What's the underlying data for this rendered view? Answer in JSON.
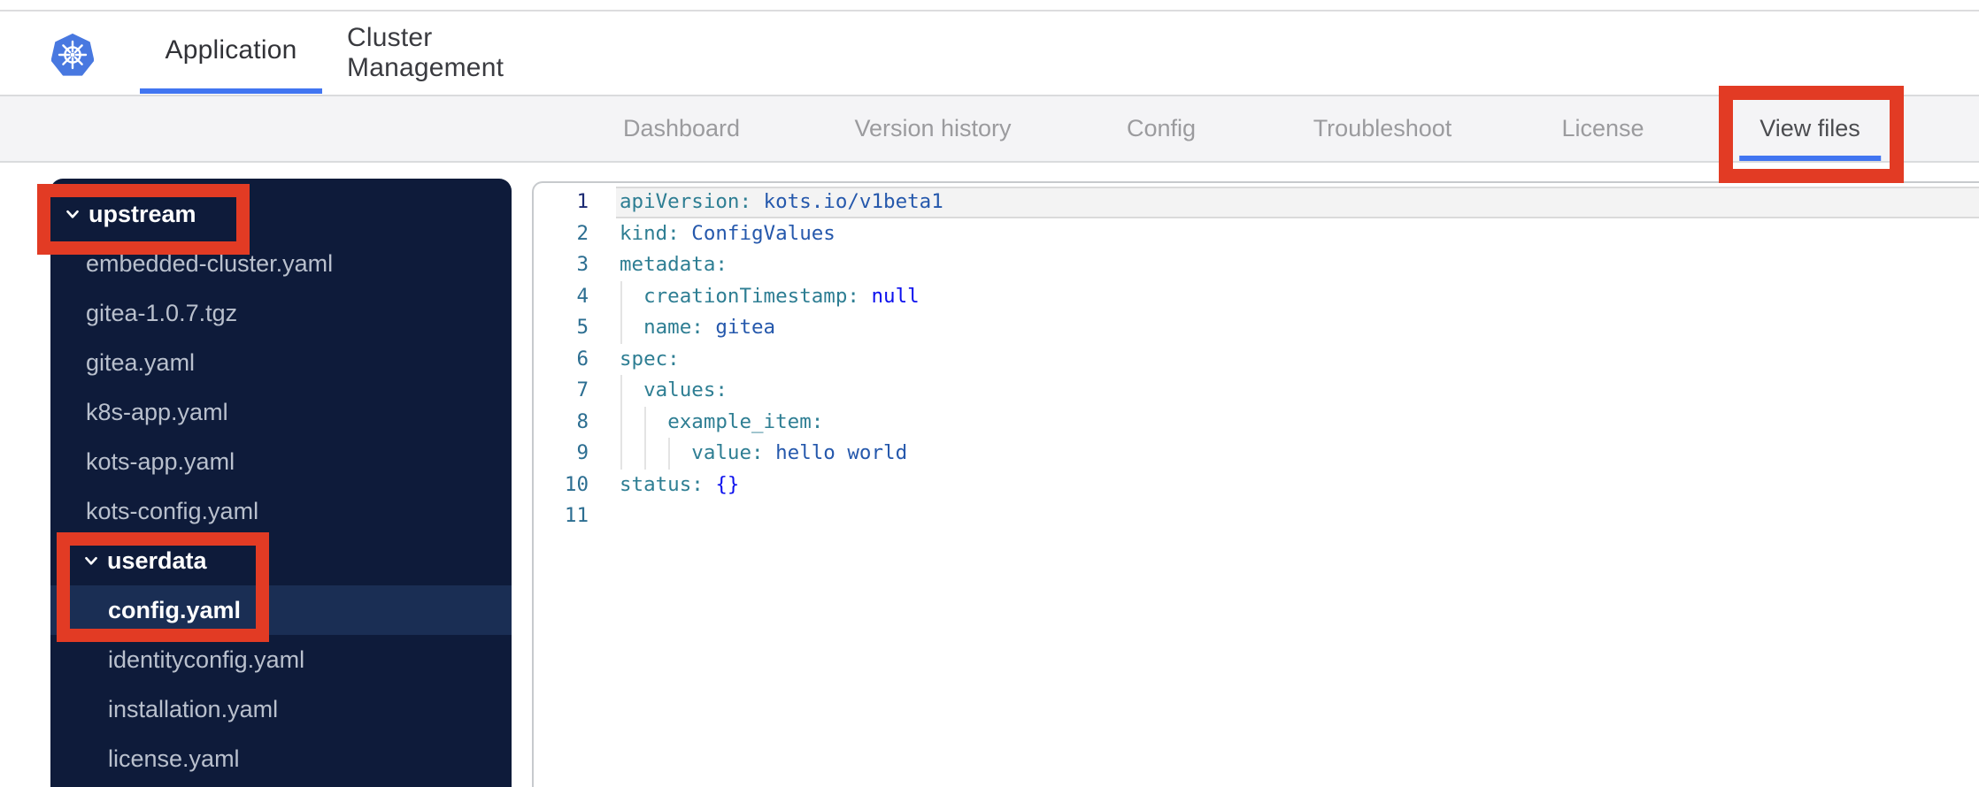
{
  "header": {
    "tabs": [
      {
        "label": "Application",
        "active": true
      },
      {
        "label": "Cluster Management",
        "active": false
      }
    ]
  },
  "nav": {
    "items": [
      "Dashboard",
      "Version history",
      "Config",
      "Troubleshoot",
      "License",
      "View files"
    ],
    "active": "View files"
  },
  "sidebar": {
    "items": [
      {
        "label": "upstream",
        "type": "folder",
        "level": 1,
        "annotated": true
      },
      {
        "label": "embedded-cluster.yaml",
        "type": "file",
        "level": 1
      },
      {
        "label": "gitea-1.0.7.tgz",
        "type": "file",
        "level": 1
      },
      {
        "label": "gitea.yaml",
        "type": "file",
        "level": 1
      },
      {
        "label": "k8s-app.yaml",
        "type": "file",
        "level": 1
      },
      {
        "label": "kots-app.yaml",
        "type": "file",
        "level": 1
      },
      {
        "label": "kots-config.yaml",
        "type": "file",
        "level": 1
      },
      {
        "label": "userdata",
        "type": "folder",
        "level": 2,
        "annotated": true
      },
      {
        "label": "config.yaml",
        "type": "file",
        "level": 2,
        "selected": true,
        "annotated": true
      },
      {
        "label": "identityconfig.yaml",
        "type": "file",
        "level": 2
      },
      {
        "label": "installation.yaml",
        "type": "file",
        "level": 2
      },
      {
        "label": "license.yaml",
        "type": "file",
        "level": 2
      }
    ]
  },
  "editor": {
    "language": "yaml",
    "lines": [
      {
        "n": "1",
        "active": true,
        "guides": [],
        "tokens": [
          [
            "key",
            "apiVersion:"
          ],
          [
            "plain",
            " "
          ],
          [
            "val",
            "kots.io/v1beta1"
          ]
        ]
      },
      {
        "n": "2",
        "guides": [],
        "tokens": [
          [
            "key",
            "kind:"
          ],
          [
            "plain",
            " "
          ],
          [
            "val",
            "ConfigValues"
          ]
        ]
      },
      {
        "n": "3",
        "guides": [],
        "tokens": [
          [
            "key",
            "metadata:"
          ]
        ]
      },
      {
        "n": "4",
        "guides": [
          0
        ],
        "tokens": [
          [
            "plain",
            "  "
          ],
          [
            "key",
            "creationTimestamp:"
          ],
          [
            "plain",
            " "
          ],
          [
            "kw",
            "null"
          ]
        ]
      },
      {
        "n": "5",
        "guides": [
          0
        ],
        "tokens": [
          [
            "plain",
            "  "
          ],
          [
            "key",
            "name:"
          ],
          [
            "plain",
            " "
          ],
          [
            "val",
            "gitea"
          ]
        ]
      },
      {
        "n": "6",
        "guides": [],
        "tokens": [
          [
            "key",
            "spec:"
          ]
        ]
      },
      {
        "n": "7",
        "guides": [
          0
        ],
        "tokens": [
          [
            "plain",
            "  "
          ],
          [
            "key",
            "values:"
          ]
        ]
      },
      {
        "n": "8",
        "guides": [
          0,
          2
        ],
        "tokens": [
          [
            "plain",
            "    "
          ],
          [
            "key",
            "example_item:"
          ]
        ]
      },
      {
        "n": "9",
        "guides": [
          0,
          2,
          4
        ],
        "tokens": [
          [
            "plain",
            "      "
          ],
          [
            "key",
            "value:"
          ],
          [
            "plain",
            " "
          ],
          [
            "val",
            "hello world"
          ]
        ]
      },
      {
        "n": "10",
        "guides": [],
        "tokens": [
          [
            "key",
            "status:"
          ],
          [
            "plain",
            " "
          ],
          [
            "kw",
            "{}"
          ]
        ]
      },
      {
        "n": "11",
        "guides": [],
        "tokens": []
      }
    ]
  },
  "annotations": {
    "color": "#e23b24",
    "targets": [
      "upstream",
      "userdata + config.yaml",
      "View files"
    ]
  },
  "colors": {
    "accent_blue": "#4175f1",
    "k8s_logo_blue": "#4878e0",
    "sidebar_bg": "#0e1b3a",
    "sidebar_selected": "#1a2e54",
    "yaml_key": "#2e7e93",
    "yaml_value": "#2558ac",
    "yaml_keyword": "#0c10ee"
  }
}
